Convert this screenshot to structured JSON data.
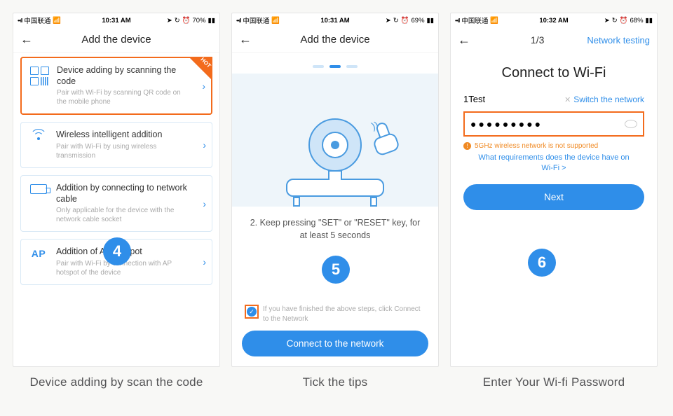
{
  "status": {
    "carrier": "中国联通",
    "time1": "10:31 AM",
    "time2": "10:31 AM",
    "time3": "10:32 AM",
    "bat1": "70%",
    "bat2": "69%",
    "bat3": "68%"
  },
  "screen1": {
    "title": "Add the device",
    "hot": "HOT",
    "opt1": {
      "t": "Device adding by scanning the code",
      "s": "Pair with Wi-Fi by scanning QR code on the mobile phone"
    },
    "opt2": {
      "t": "Wireless intelligent addition",
      "s": "Pair with Wi-Fi by using wireless transmission"
    },
    "opt3": {
      "t": "Addition by connecting to network cable",
      "s": "Only applicable for the device with the network cable socket"
    },
    "opt4": {
      "t": "Addition of AP hotspot",
      "s": "Pair with Wi-Fi by connection with AP hotspot of the device"
    },
    "badge": "4"
  },
  "screen2": {
    "title": "Add the device",
    "instr": "2. Keep pressing \"SET\" or \"RESET\" key, for at least 5 seconds",
    "tick": "If you have finished the above steps, click Connect to the Network",
    "cta": "Connect to the network",
    "badge": "5"
  },
  "screen3": {
    "step": "1/3",
    "netTesting": "Network testing",
    "title": "Connect to Wi-Fi",
    "ssid": "1Test",
    "switch": "Switch the network",
    "pwd": "●●●●●●●●●",
    "warn": "5GHz wireless network is not supported",
    "req": "What requirements does the device have on Wi-Fi >",
    "cta": "Next",
    "badge": "6"
  },
  "captions": {
    "c1": "Device adding by scan the code",
    "c2": "Tick the tips",
    "c3": "Enter Your Wi-fi Password"
  }
}
